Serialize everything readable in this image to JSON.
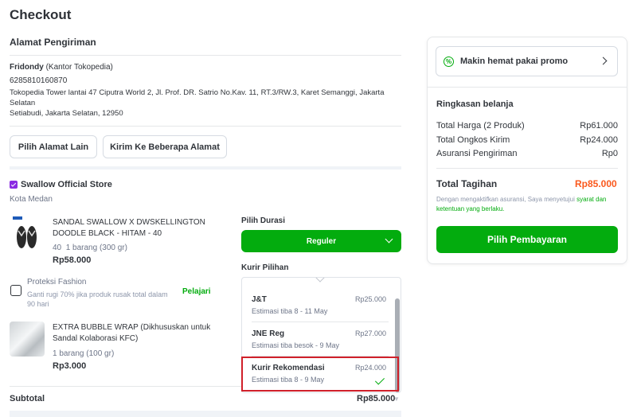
{
  "page": {
    "title": "Checkout"
  },
  "address": {
    "section_title": "Alamat Pengiriman",
    "name": "Fridondy",
    "label": "(Kantor Tokopedia)",
    "phone": "6285810160870",
    "line1": "Tokopedia Tower lantai 47 Ciputra World 2, Jl. Prof. DR. Satrio No.Kav. 11, RT.3/RW.3, Karet Semanggi, Jakarta",
    "line2": "Selatan",
    "line3": "Setiabudi, Jakarta Selatan, 12950",
    "btn_other": "Pilih Alamat Lain",
    "btn_multi": "Kirim Ke Beberapa Alamat"
  },
  "store": {
    "name": "Swallow Official Store",
    "city": "Kota Medan",
    "products": [
      {
        "name_line1": "SANDAL SWALLOW X DWSKELLINGTON",
        "name_line2": "DOODLE BLACK - HITAM - 40",
        "variant": "40",
        "qty": "1 barang (300 gr)",
        "price": "Rp58.000"
      },
      {
        "name_line1": "EXTRA BUBBLE WRAP (Dikhususkan untuk",
        "name_line2": "Sandal Kolaborasi KFC)",
        "qty": "1 barang (100 gr)",
        "price": "Rp3.000"
      }
    ],
    "protection": {
      "title": "Proteksi Fashion",
      "desc_line1": "Ganti rugi 70% jika produk rusak total dalam",
      "desc_line2": "90 hari",
      "link": "Pelajari"
    },
    "subtotal_label": "Subtotal",
    "subtotal_value": "Rp85.000"
  },
  "shipping": {
    "duration_label": "Pilih Durasi",
    "duration_value": "Reguler",
    "courier_label": "Kurir Pilihan",
    "options": [
      {
        "name": "J&T",
        "eta": "Estimasi tiba 8 - 11 May",
        "price": "Rp25.000"
      },
      {
        "name": "JNE Reg",
        "eta": "Estimasi tiba besok - 9 May",
        "price": "Rp27.000"
      },
      {
        "name": "Kurir Rekomendasi",
        "eta": "Estimasi tiba 8 - 9 May",
        "price": "Rp24.000",
        "selected": true
      }
    ]
  },
  "summary": {
    "promo_label": "Makin hemat pakai promo",
    "title": "Ringkasan belanja",
    "rows": [
      {
        "label": "Total Harga (2 Produk)",
        "value": "Rp61.000"
      },
      {
        "label": "Total Ongkos Kirim",
        "value": "Rp24.000"
      },
      {
        "label": "Asuransi Pengiriman",
        "value": "Rp0"
      }
    ],
    "total_label": "Total Tagihan",
    "total_value": "Rp85.000",
    "disclaimer_pre": "Dengan mengaktifkan asuransi, Saya menyetujui ",
    "disclaimer_link1": "syarat dan",
    "disclaimer_link2": "ketentuan yang berlaku.",
    "pay_button": "Pilih Pembayaran"
  },
  "colors": {
    "accent": "#03ac0e",
    "total": "#fa591d",
    "highlight": "#d0202a"
  }
}
